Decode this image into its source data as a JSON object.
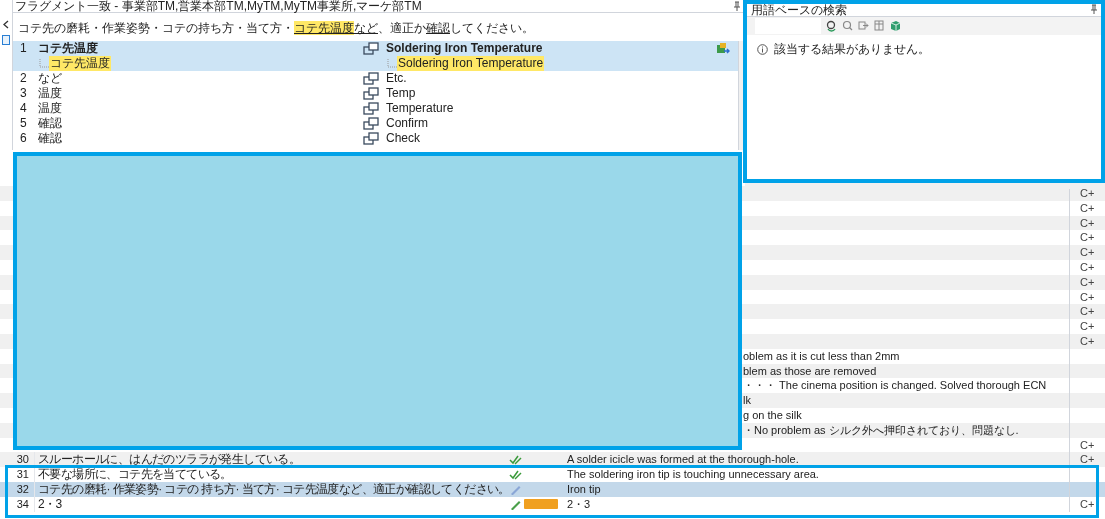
{
  "fragment_panel": {
    "title": "フラグメント一致 - 事業部TM,営業本部TM,MyTM,MyTM事業所,マーケ部TM",
    "source_segments": [
      {
        "text": "コテ先の磨耗・作業姿勢・コテの持ち方・当て方・",
        "highlight": false,
        "underline": false
      },
      {
        "text": "コテ先温度",
        "highlight": true,
        "underline": true
      },
      {
        "text": "など",
        "highlight": false,
        "underline": true
      },
      {
        "text": "、適正か",
        "highlight": false,
        "underline": false
      },
      {
        "text": "確認",
        "highlight": false,
        "underline": true
      },
      {
        "text": "してください。",
        "highlight": false,
        "underline": false
      }
    ],
    "rows": [
      {
        "number": "1",
        "source": "コテ先温度",
        "source_term": "コテ先温度",
        "target": "Soldering Iron Temperature",
        "target_term": "Soldering Iron Temperature",
        "selected": true
      },
      {
        "number": "2",
        "source": "など",
        "target": "Etc.",
        "selected": false
      },
      {
        "number": "3",
        "source": "温度",
        "target": "Temp",
        "selected": false
      },
      {
        "number": "4",
        "source": "温度",
        "target": "Temperature",
        "selected": false
      },
      {
        "number": "5",
        "source": "確認",
        "target": "Confirm",
        "selected": false
      },
      {
        "number": "6",
        "source": "確認",
        "target": "Check",
        "selected": false
      }
    ]
  },
  "termbase_panel": {
    "title": "用語ベースの検索",
    "message": "該当する結果がありません。"
  },
  "editor": {
    "rows": [
      {
        "kind": "covered",
        "status": "C+"
      },
      {
        "kind": "covered",
        "status": "C+"
      },
      {
        "kind": "covered",
        "status": "C+"
      },
      {
        "kind": "covered",
        "status": "C+"
      },
      {
        "kind": "covered",
        "status": "C+"
      },
      {
        "kind": "covered",
        "status": "C+"
      },
      {
        "kind": "covered",
        "status": "C+"
      },
      {
        "kind": "covered",
        "status": "C+"
      },
      {
        "kind": "covered",
        "status": "C+"
      },
      {
        "kind": "covered",
        "status": "C+"
      },
      {
        "kind": "covered",
        "status": "C+"
      },
      {
        "kind": "covered",
        "target": "oblem as it is cut less than 2mm"
      },
      {
        "kind": "covered",
        "target": "blem as those are removed"
      },
      {
        "kind": "covered",
        "target": "・・・ The cinema position is changed. Solved thorough ECN"
      },
      {
        "kind": "covered",
        "target": "lk"
      },
      {
        "kind": "covered",
        "target": "g on the silk"
      },
      {
        "kind": "covered",
        "target": "・No problem as シルク外へ押印されており、問題なし."
      },
      {
        "kind": "covered",
        "status": "C+"
      },
      {
        "kind": "confirmed",
        "number": "30",
        "source": "スルーホールに、はんだのツララが発生している。",
        "target": "A solder icicle was formed at the thorough-hole.",
        "status": "C+",
        "selected": false
      },
      {
        "kind": "confirmed",
        "number": "31",
        "source": "不要な場所に、コテ先を当てている。",
        "target": "The soldering iron tip is touching unnecessary area.",
        "selected": false
      },
      {
        "kind": "draft",
        "number": "32",
        "source": "コテ先の磨耗· 作業姿勢· コテの 持ち方· 当て方· コテ先温度など、適正か確認してください。",
        "target": "Iron tip",
        "selected": true
      },
      {
        "kind": "match",
        "number": "34",
        "source": "2・3",
        "target": "2・3",
        "status": "C+",
        "selected": false
      }
    ]
  }
}
